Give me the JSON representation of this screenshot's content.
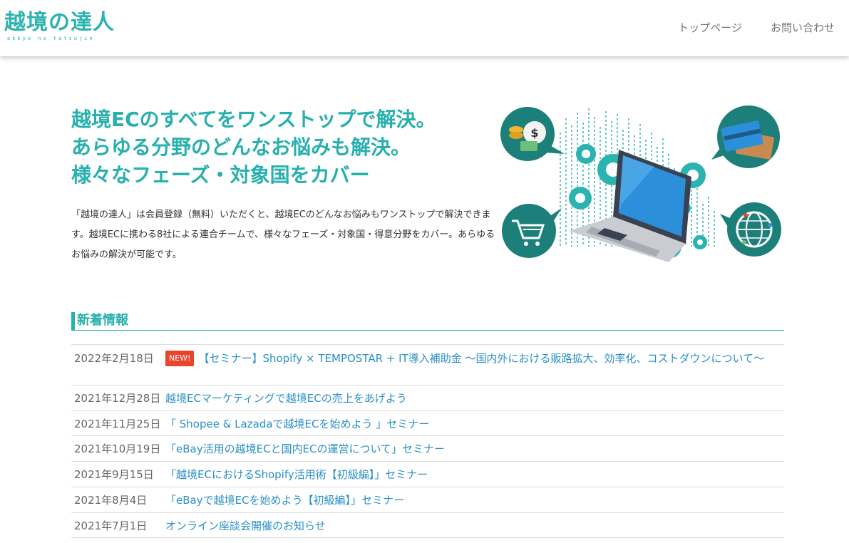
{
  "header": {
    "logo_text": "越境の達人",
    "logo_sub": "ekkyo no tatsujin",
    "nav": [
      "トップページ",
      "お問い合わせ"
    ]
  },
  "hero": {
    "title_lines": [
      "越境ECのすべてをワンストップで解決。",
      "あらゆる分野のどんなお悩みも解決。",
      "様々なフェーズ・対象国をカバー"
    ],
    "description": "「越境の達人」は会員登録（無料）いただくと、越境ECのどんなお悩みもワンストップで解決できます。越境ECに携わる8社による連合チームで、様々なフェーズ・対象国・得意分野をカバー。あらゆるお悩みの解決が可能です。"
  },
  "news": {
    "heading": "新着情報",
    "new_label": "NEW!",
    "items": [
      {
        "date": "2022年2月18日",
        "title": "【セミナー】Shopify × TEMPOSTAR + IT導入補助金 ～国内外における販路拡大、効率化、コストダウンについて～"
      },
      {
        "date": "2021年12月28日",
        "title": "越境ECマーケティングで越境ECの売上をあげよう"
      },
      {
        "date": "2021年11月25日",
        "title": "「 Shopee & Lazadaで越境ECを始めよう 」セミナー"
      },
      {
        "date": "2021年10月19日",
        "title": "「eBay活用の越境ECと国内ECの運営について」セミナー"
      },
      {
        "date": "2021年9月15日",
        "title": "「越境ECにおけるShopify活用術【初級編】」セミナー"
      },
      {
        "date": "2021年8月4日",
        "title": "「eBayで越境ECを始めよう【初級編】」セミナー"
      },
      {
        "date": "2021年7月1日",
        "title": "オンライン座談会開催のお知らせ"
      }
    ]
  },
  "colors": {
    "brand": "#27b0ad",
    "link": "#2a8fc7",
    "badge": "#e8452c",
    "illustration_dark": "#1d7f7a"
  }
}
